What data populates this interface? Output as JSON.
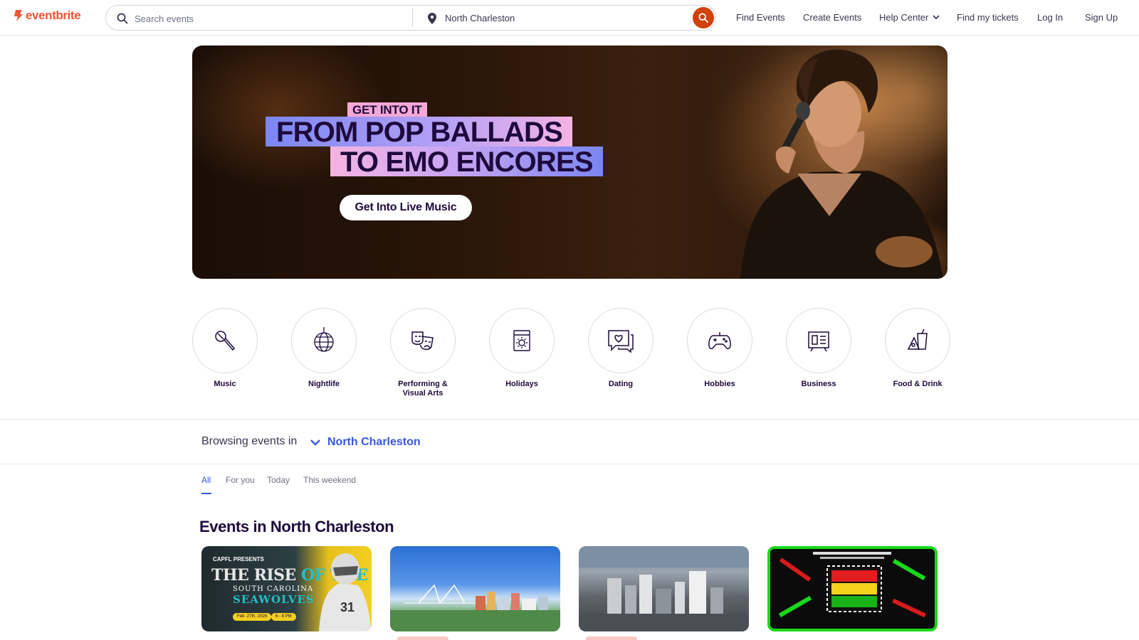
{
  "header": {
    "logo_text": "eventbrite",
    "search_placeholder": "Search events",
    "location_value": "North Charleston",
    "nav": [
      "Find Events",
      "Create Events",
      "Help Center",
      "Find my tickets",
      "Log In",
      "Sign Up"
    ],
    "icons": [
      "search-icon",
      "location-pin-icon",
      "search-button-icon",
      "chevron-down-icon"
    ]
  },
  "hero": {
    "eyebrow": "GET INTO IT",
    "headline_line1": "FROM POP BALLADS",
    "headline_line2": "TO EMO ENCORES",
    "cta_label": "Get Into Live Music"
  },
  "categories": [
    {
      "label": "Music",
      "icon": "microphone-icon"
    },
    {
      "label": "Nightlife",
      "icon": "disco-ball-icon"
    },
    {
      "label": "Performing & Visual Arts",
      "icon": "theater-masks-icon"
    },
    {
      "label": "Holidays",
      "icon": "calendar-sun-icon"
    },
    {
      "label": "Dating",
      "icon": "chat-heart-icon"
    },
    {
      "label": "Hobbies",
      "icon": "gamepad-icon"
    },
    {
      "label": "Business",
      "icon": "presentation-icon"
    },
    {
      "label": "Food & Drink",
      "icon": "drinks-icon"
    }
  ],
  "browsing": {
    "label": "Browsing events in",
    "location": "North Charleston"
  },
  "tabs": [
    {
      "label": "All",
      "active": true
    },
    {
      "label": "For you",
      "active": false
    },
    {
      "label": "Today",
      "active": false
    },
    {
      "label": "This weekend",
      "active": false
    }
  ],
  "events_section": {
    "title": "Events in North Charleston",
    "card1": {
      "brand": "CAPFL PRESENTS",
      "rise_a": "THE RISE ",
      "rise_b": "OF THE",
      "line_sc": "SOUTH CAROLINA",
      "line_team": "SEAWOLVES",
      "date": "Feb. 27th, 2026",
      "time": "6 - 8 PM"
    }
  },
  "colors": {
    "brand": "#f05537",
    "accent_blue": "#3659e3",
    "search_button": "#d1410c",
    "text_dark": "#1e0a3c"
  }
}
